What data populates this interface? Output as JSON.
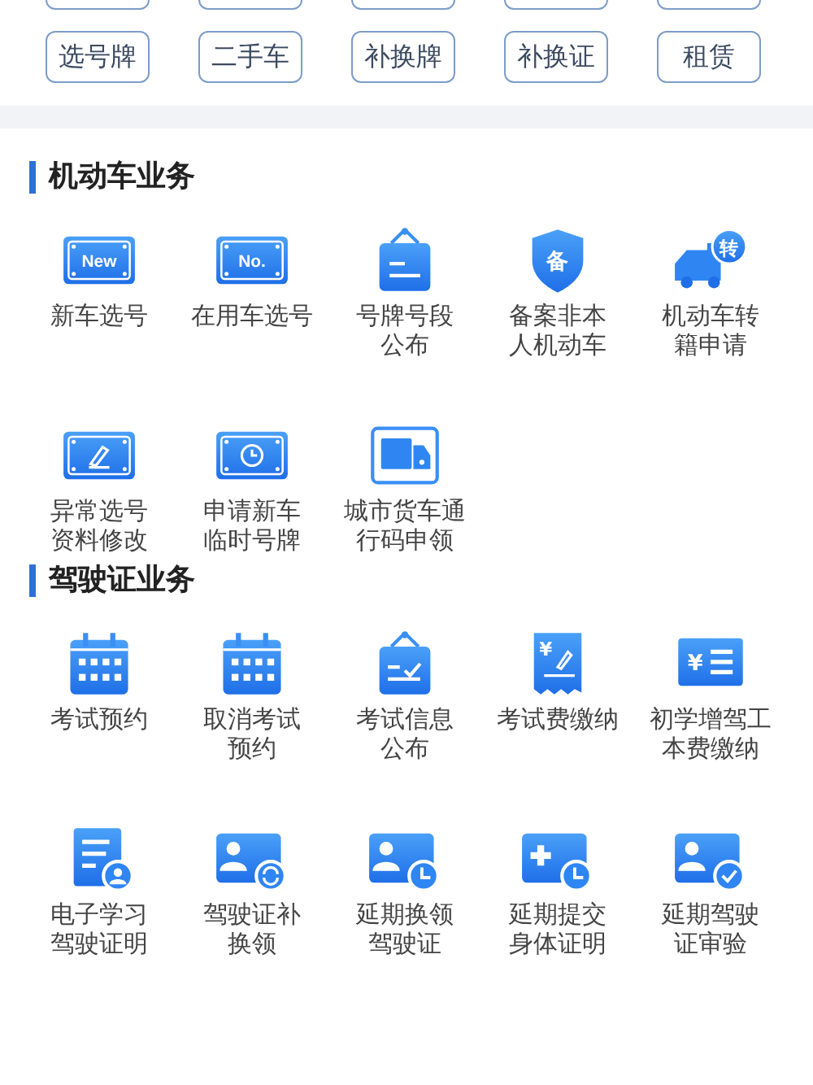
{
  "quick_buttons": [
    "选号牌",
    "二手车",
    "补换牌",
    "补换证",
    "租赁"
  ],
  "sections": [
    {
      "title": "机动车业务",
      "items": [
        {
          "kind": "plate-new",
          "icon_text": "New",
          "lines": [
            "新车选号"
          ]
        },
        {
          "kind": "plate-no",
          "icon_text": "No.",
          "lines": [
            "在用车选号"
          ]
        },
        {
          "kind": "sign",
          "lines": [
            "号牌号段",
            "公布"
          ]
        },
        {
          "kind": "shield",
          "icon_text": "备",
          "lines": [
            "备案非本",
            "人机动车"
          ]
        },
        {
          "kind": "truck",
          "icon_text": "转",
          "lines": [
            "机动车转",
            "籍申请"
          ]
        },
        {
          "kind": "plate-edit",
          "lines": [
            "异常选号",
            "资料修改"
          ]
        },
        {
          "kind": "plate-clock",
          "lines": [
            "申请新车",
            "临时号牌"
          ]
        },
        {
          "kind": "box-truck",
          "lines": [
            "城市货车通",
            "行码申领"
          ]
        }
      ]
    },
    {
      "title": "驾驶证业务",
      "items": [
        {
          "kind": "calendar",
          "lines": [
            "考试预约"
          ]
        },
        {
          "kind": "calendar",
          "lines": [
            "取消考试",
            "预约"
          ]
        },
        {
          "kind": "sign-check",
          "lines": [
            "考试信息",
            "公布"
          ]
        },
        {
          "kind": "receipt",
          "icon_text": "¥",
          "lines": [
            "考试费缴纳"
          ]
        },
        {
          "kind": "yen-list",
          "icon_text": "¥",
          "lines": [
            "初学增驾工",
            "本费缴纳"
          ]
        },
        {
          "kind": "doc-person",
          "lines": [
            "电子学习",
            "驾驶证明"
          ]
        },
        {
          "kind": "id-swap",
          "lines": [
            "驾驶证补",
            "换领"
          ]
        },
        {
          "kind": "id-clock",
          "lines": [
            "延期换领",
            "驾驶证"
          ]
        },
        {
          "kind": "plus-clock",
          "lines": [
            "延期提交",
            "身体证明"
          ]
        },
        {
          "kind": "id-check",
          "lines": [
            "延期驾驶",
            "证审验"
          ]
        }
      ]
    }
  ]
}
